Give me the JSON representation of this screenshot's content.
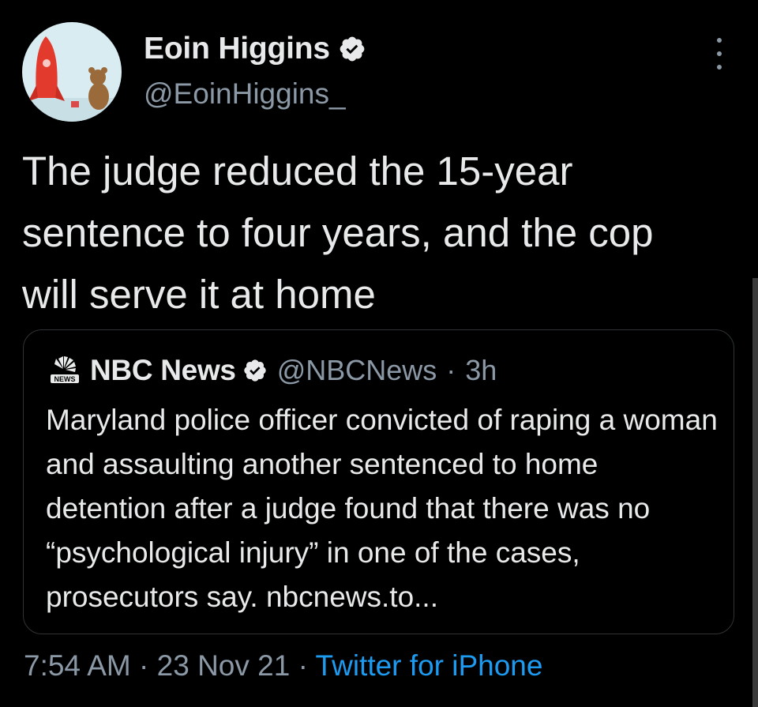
{
  "author": {
    "display_name": "Eoin Higgins",
    "handle": "@EoinHiggins_",
    "verified": true,
    "avatar": "cartoon-rocket-and-teddy-bear-avatar"
  },
  "tweet": {
    "text": "The judge reduced the 15-year sentence to four years, and the cop will serve it at home"
  },
  "quoted_tweet": {
    "logo": "nbc-peacock-news-logo",
    "display_name": "NBC News",
    "handle": "@NBCNews",
    "separator": "·",
    "age": "3h",
    "text": "Maryland police officer convicted of raping a woman and assaulting another sentenced to home detention after a judge found that there was no “psychological injury” in one of the cases, prosecutors say. nbcnews.to..."
  },
  "footer": {
    "time": "7:54 AM",
    "sep1": " · ",
    "date": "23 Nov 21",
    "sep2": " · ",
    "source": "Twitter for iPhone"
  },
  "colors": {
    "background": "#000000",
    "primary_text": "#e7e9ea",
    "secondary_text": "#8b98a5",
    "link": "#1d9bf0",
    "border": "#2f3336"
  },
  "icons": {
    "verified": "verified-badge-icon",
    "more": "more-options-icon"
  }
}
